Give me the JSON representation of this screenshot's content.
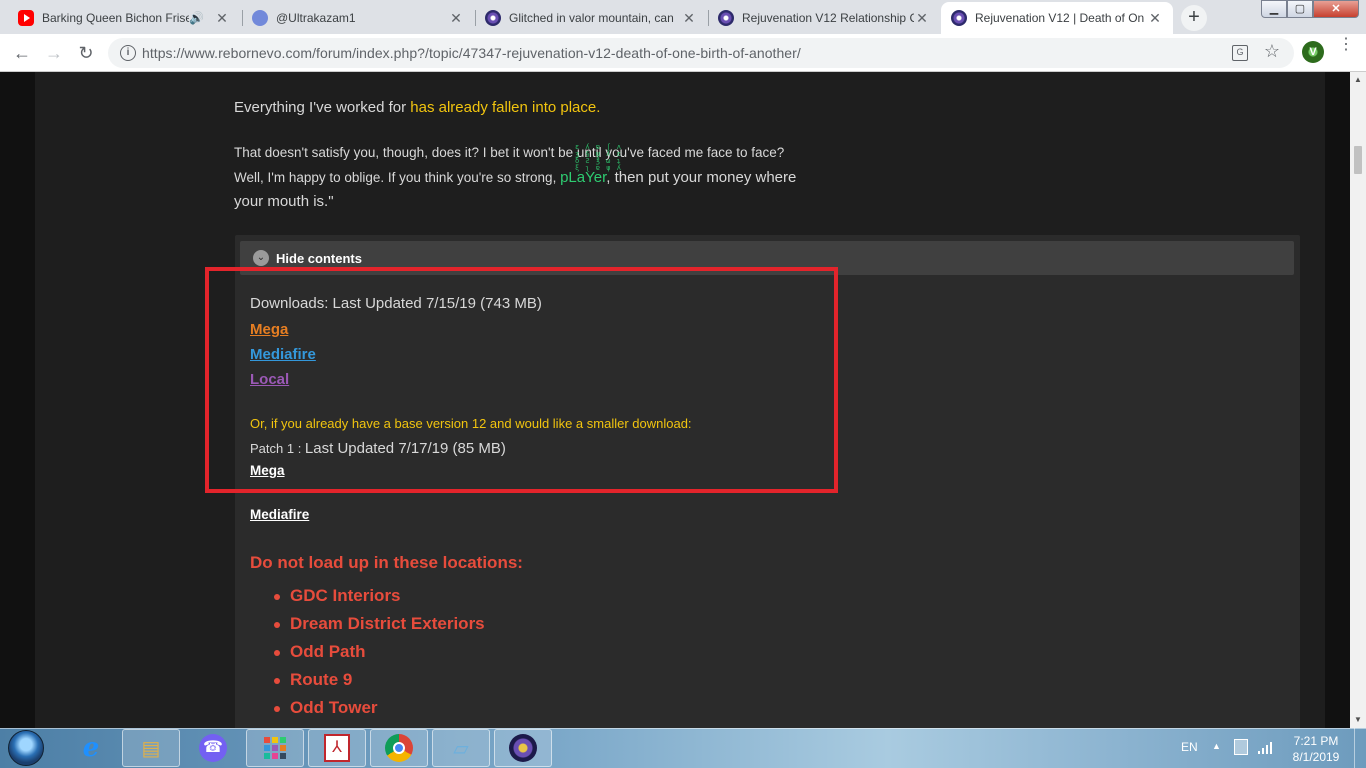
{
  "browser": {
    "tabs": [
      {
        "label": "Barking Queen Bichon Frise",
        "favicon": "youtube-icon",
        "extra": "🔊"
      },
      {
        "label": "@Ultrakazam1",
        "favicon": "discord-icon"
      },
      {
        "label": "Glitched in valor mountain, can",
        "favicon": "reborn-forum-icon"
      },
      {
        "label": "Rejuvenation V12 Relationship C",
        "favicon": "reborn-forum-icon"
      },
      {
        "label": "Rejuvenation V12 | Death of On",
        "favicon": "reborn-forum-icon",
        "active": true
      }
    ],
    "new_tab": "+",
    "url": "https://www.rebornevo.com/forum/index.php?/topic/47347-rejuvenation-v12-death-of-one-birth-of-another/",
    "info_icon": "i",
    "translate_icon": "G",
    "star_icon": "☆",
    "back": "←",
    "forward": "→",
    "reload": "↻"
  },
  "post": {
    "worked_prefix": "Everything I've worked for ",
    "worked_highlight": "has already fallen into place.",
    "satisfy_line": "That doesn't satisfy you, though, does it? I bet it won't be until you've faced me face to face?",
    "happy_prefix": "Well, I'm happy to oblige. If you think you're so strong, ",
    "player_word": "pLaYer",
    "happy_suffix": ", then put your money where",
    "mouth_line": "your mouth is.\"",
    "glitch": "ε ʎ ɐ ʃ ʌ  ʒ § ψ ʎ ε  δ Ƨ ℥ ω ʇ  ξ ʅ ɐ ψ ʎ"
  },
  "spoiler": {
    "toggle_label": "Hide contents",
    "downloads_title": "Downloads: Last Updated 7/15/19 (743 MB)",
    "link_mega": "Mega",
    "link_mediafire": "Mediafire",
    "link_local": "Local",
    "patch_note": "Or, if you already have a base version 12 and would like a smaller download:",
    "patch_title_a": "Patch 1 : ",
    "patch_title_b": "Last Updated 7/17/19 (85 MB)",
    "patch_mega": "Mega",
    "patch_mediafire": "Mediafire",
    "warning_heading": "Do not load up in these locations:",
    "locations": [
      "GDC Interiors",
      "Dream District Exteriors",
      "Odd Path",
      "Route 9",
      "Odd Tower"
    ]
  },
  "taskbar": {
    "language": "EN",
    "time": "7:21 PM",
    "date": "8/1/2019",
    "apps": [
      "start-orb",
      "internet-explorer-icon",
      "file-explorer-icon",
      "viber-icon",
      "apps-grid-icon",
      "acrobat-icon",
      "chrome-icon",
      "notes-icon",
      "pokemon-game-icon"
    ]
  },
  "colors": {
    "highlight_box": "#e3242b",
    "link_mega": "#e67e22",
    "link_mediafire": "#3498db",
    "link_local": "#9b59b6",
    "warning": "#e74c3c",
    "yellow_text": "#f1c40f",
    "player_green": "#2ecc71"
  }
}
